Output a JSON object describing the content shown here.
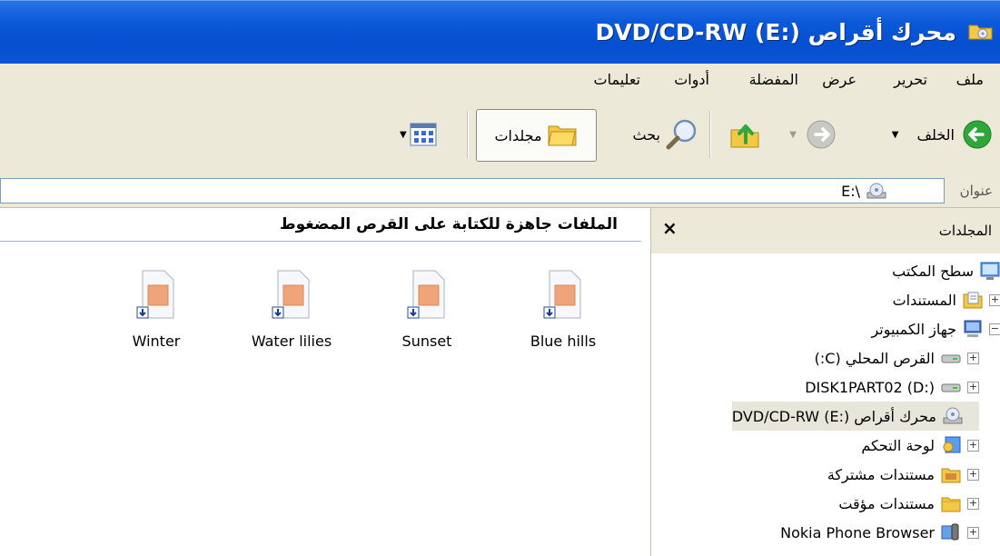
{
  "window": {
    "title": "محرك أقراص DVD/CD-RW (E:)"
  },
  "menu": [
    "ملف",
    "تحرير",
    "عرض",
    "المفضلة",
    "أدوات",
    "تعليمات"
  ],
  "toolbar": {
    "back_label": "الخلف",
    "search_label": "بحث",
    "folders_label": "مجلدات"
  },
  "address": {
    "label": "عنوان",
    "value": "E:\\"
  },
  "content": {
    "header": "الملفات جاهزة للكتابة على القرص المضغوط",
    "files": [
      "Blue hills",
      "Sunset",
      "Water lilies",
      "Winter"
    ]
  },
  "folders_pane": {
    "title": "المجلدات",
    "close_label": "×",
    "tree": [
      {
        "label": "سطح المكتب",
        "icon": "desktop-icon"
      },
      {
        "label": "المستندات",
        "icon": "documents-icon"
      },
      {
        "label": "جهاز الكمبيوتر",
        "icon": "computer-icon"
      },
      {
        "label": "القرص المحلي (C:)",
        "icon": "drive-icon"
      },
      {
        "label": "DISK1PART02 (D:)",
        "icon": "drive-icon"
      },
      {
        "label": "محرك أقراص DVD/CD-RW (E:)",
        "icon": "cd-drive-icon"
      },
      {
        "label": "لوحة التحكم",
        "icon": "control-panel-icon"
      },
      {
        "label": "مستندات مشتركة",
        "icon": "shared-folder-icon"
      },
      {
        "label": "مستندات مؤقت",
        "icon": "folder-icon"
      },
      {
        "label": "Nokia Phone Browser",
        "icon": "phone-icon"
      }
    ]
  },
  "colors": {
    "titlebar": "#0a58d8",
    "chrome": "#ece9d8",
    "header_rule": "#9fb8d8"
  }
}
